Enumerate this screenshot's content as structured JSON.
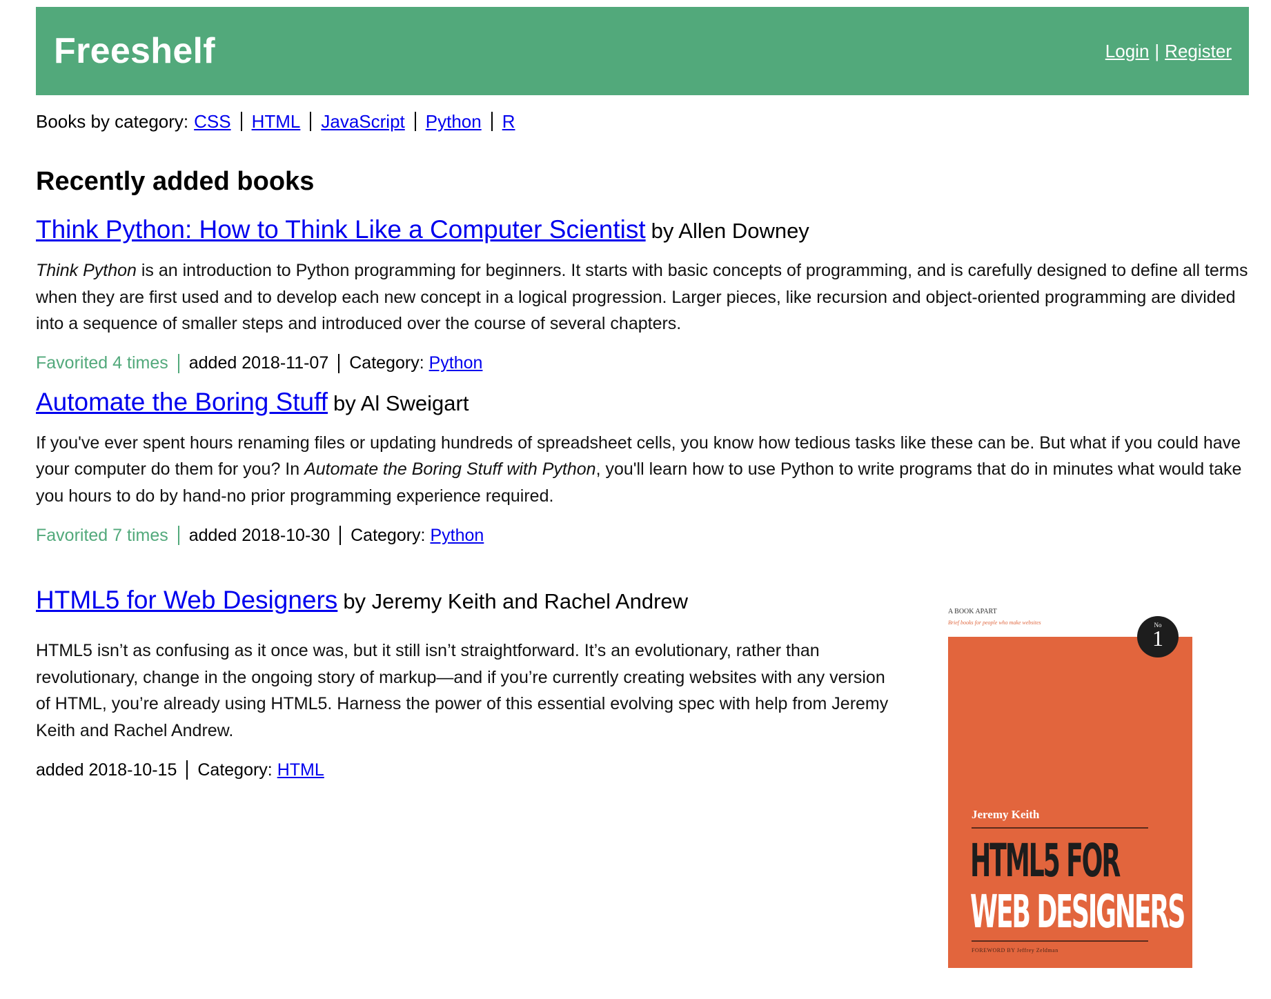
{
  "header": {
    "brand": "Freeshelf",
    "login": "Login",
    "divider": "|",
    "register": "Register",
    "color": "#52a97b"
  },
  "categories": {
    "label": "Books by category:",
    "items": [
      "CSS",
      "HTML",
      "JavaScript",
      "Python",
      "R"
    ]
  },
  "section_title": "Recently added books",
  "books": [
    {
      "title": "Think Python: How to Think Like a Computer Scientist",
      "by": "by Allen Downey",
      "desc_italic": "Think Python",
      "desc_rest": " is an introduction to Python programming for beginners. It starts with basic concepts of programming, and is carefully designed to define all terms when they are first used and to develop each new concept in a logical progression. Larger pieces, like recursion and object-oriented programming are divided into a sequence of smaller steps and introduced over the course of several chapters.",
      "favorited": "Favorited 4 times",
      "added": "added 2018-11-07",
      "category_label": "Category:",
      "category": "Python"
    },
    {
      "title": "Automate the Boring Stuff",
      "by": "by Al Sweigart",
      "desc_before": "If you've ever spent hours renaming files or updating hundreds of spreadsheet cells, you know how tedious tasks like these can be. But what if you could have your computer do them for you? In ",
      "desc_italic": "Automate the Boring Stuff with Python",
      "desc_after": ", you'll learn how to use Python to write programs that do in minutes what would take you hours to do by hand-no prior programming experience required.",
      "favorited": "Favorited 7 times",
      "added": "added 2018-10-30",
      "category_label": "Category:",
      "category": "Python"
    },
    {
      "title": "HTML5 for Web Designers",
      "by": "by Jeremy Keith and Rachel Andrew",
      "desc": "HTML5 isn’t as confusing as it once was, but it still isn’t straightforward. It’s an evolutionary, rather than revolutionary, change in the ongoing story of markup—and if you’re currently creating websites with any version of HTML, you’re already using HTML5. Harness the power of this essential evolving spec with help from Jeremy Keith and Rachel Andrew.",
      "added": "added 2018-10-15",
      "category_label": "Category:",
      "category": "HTML",
      "cover": {
        "publisher": "A BOOK APART",
        "tagline": "Brief books for people who make websites",
        "number_prefix": "No",
        "number": "1",
        "author": "Jeremy Keith",
        "title_line1": "HTML5 FOR",
        "title_line2": "WEB DESIGNERS",
        "foreword": "FOREWORD BY Jeffrey Zeldman",
        "color": "#e2653d"
      }
    }
  ]
}
